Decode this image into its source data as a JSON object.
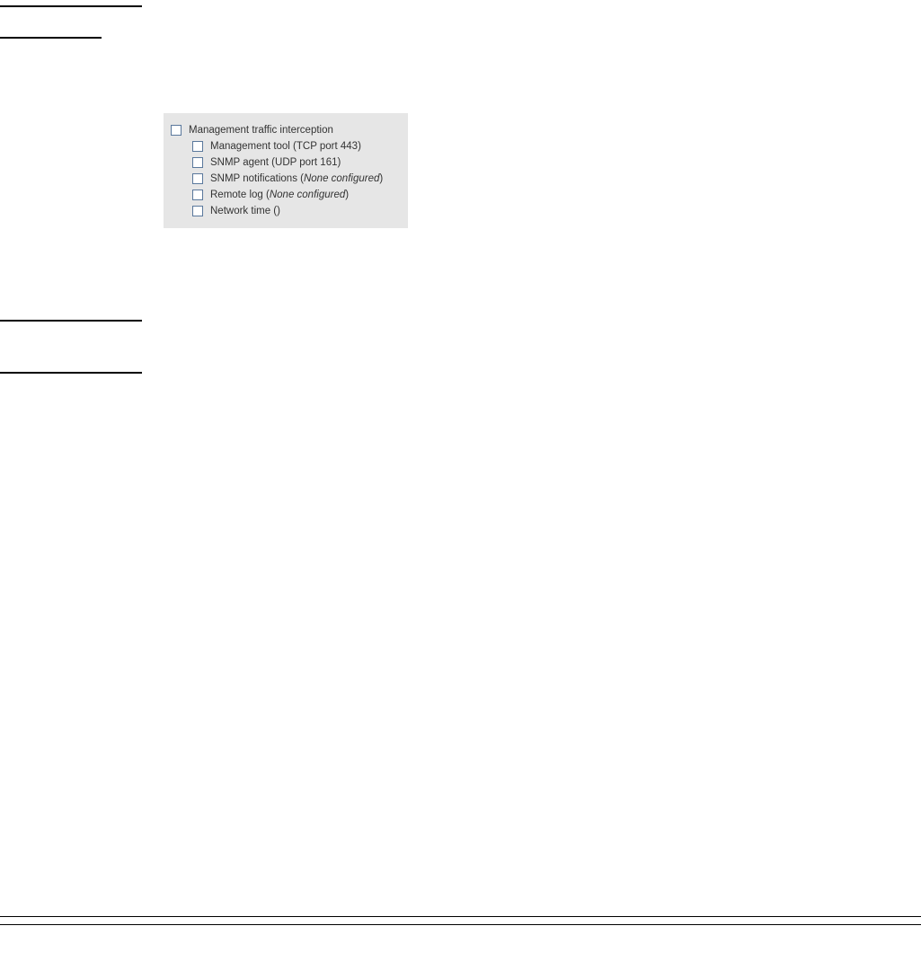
{
  "panel": {
    "parent_label": "Management traffic interception",
    "items": [
      {
        "label": "Management tool (TCP port 443)",
        "note": ""
      },
      {
        "label": "SNMP agent (UDP port 161)",
        "note": ""
      },
      {
        "label": "SNMP notifications (",
        "note": "None configured",
        "suffix": ")"
      },
      {
        "label": "Remote log (",
        "note": "None configured",
        "suffix": ")"
      },
      {
        "label": "Network time ()",
        "note": ""
      }
    ]
  }
}
